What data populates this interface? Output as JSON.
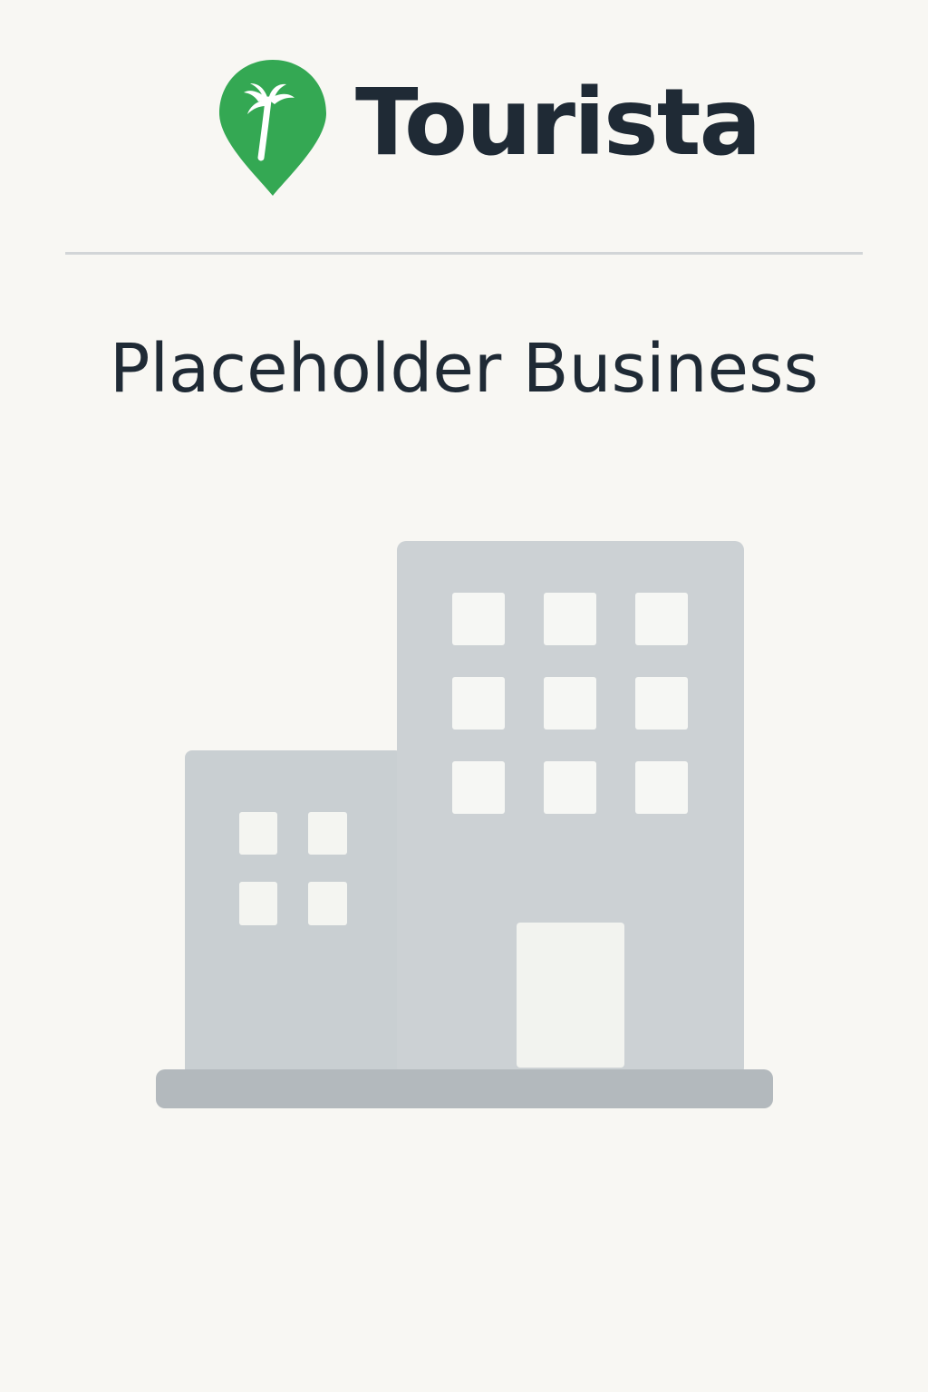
{
  "brand": {
    "name": "Tourista",
    "logo_icon": "palm-tree-map-pin-icon",
    "logo_color": "#34a853",
    "text_color": "#1f2a35"
  },
  "business": {
    "name": "Placeholder Business"
  },
  "illustration": {
    "icon": "building-placeholder-icon",
    "building_color": "#c9cfd2",
    "ground_color": "#b3b9bd",
    "window_color": "#f4f5f1"
  }
}
